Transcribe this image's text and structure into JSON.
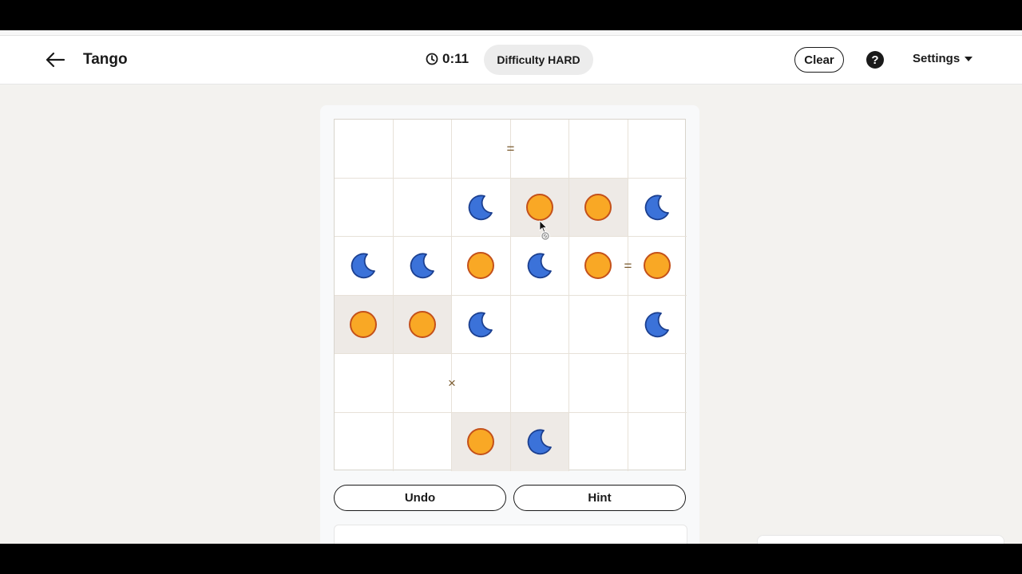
{
  "header": {
    "title": "Tango",
    "timer": "0:11",
    "difficulty": "Difficulty HARD",
    "clear_label": "Clear",
    "help_label": "?",
    "settings_label": "Settings"
  },
  "colors": {
    "sun_fill": "#f9a825",
    "sun_stroke": "#c4511a",
    "moon_fill": "#3b72d9",
    "moon_stroke": "#1b3f8f",
    "locked_cell": "#eeeae6"
  },
  "board": {
    "size": 6,
    "cells": [
      [
        "empty",
        "empty",
        "empty",
        "empty",
        "empty",
        "empty"
      ],
      [
        "empty",
        "empty",
        "moon",
        "sun",
        "sun",
        "moon"
      ],
      [
        "moon",
        "moon",
        "sun",
        "moon",
        "sun",
        "sun"
      ],
      [
        "sun",
        "sun",
        "moon",
        "empty",
        "empty",
        "moon"
      ],
      [
        "empty",
        "empty",
        "empty",
        "empty",
        "empty",
        "empty"
      ],
      [
        "empty",
        "empty",
        "sun",
        "moon",
        "empty",
        "empty"
      ]
    ],
    "locked": [
      [
        false,
        false,
        false,
        false,
        false,
        false
      ],
      [
        false,
        false,
        false,
        true,
        true,
        false
      ],
      [
        false,
        false,
        false,
        false,
        false,
        false
      ],
      [
        true,
        true,
        false,
        false,
        false,
        false
      ],
      [
        false,
        false,
        false,
        false,
        false,
        false
      ],
      [
        false,
        false,
        true,
        true,
        false,
        false
      ]
    ],
    "constraints": [
      {
        "row": 0,
        "col": 2,
        "dir": "right",
        "symbol": "="
      },
      {
        "row": 2,
        "col": 4,
        "dir": "right",
        "symbol": "="
      },
      {
        "row": 4,
        "col": 1,
        "dir": "right",
        "symbol": "×"
      }
    ]
  },
  "buttons": {
    "undo": "Undo",
    "hint": "Hint"
  }
}
